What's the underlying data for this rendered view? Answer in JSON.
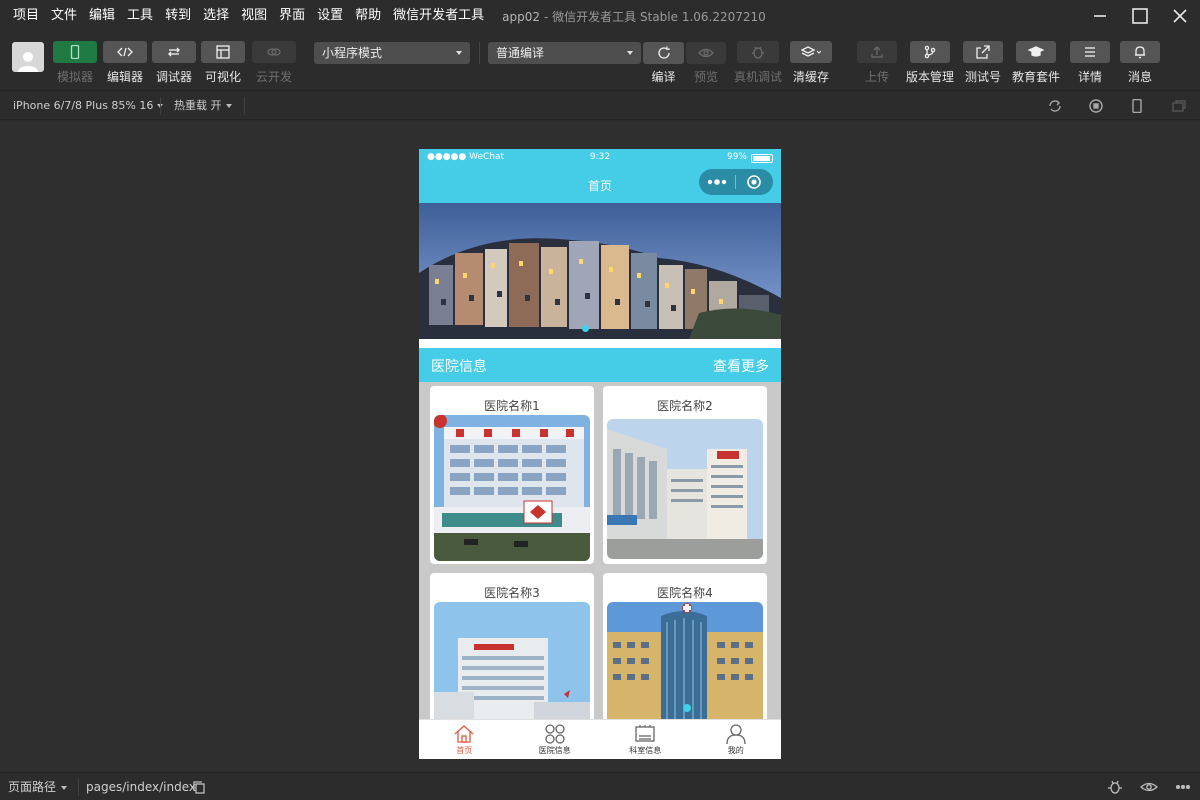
{
  "menu": [
    "项目",
    "文件",
    "编辑",
    "工具",
    "转到",
    "选择",
    "视图",
    "界面",
    "设置",
    "帮助",
    "微信开发者工具"
  ],
  "app": {
    "name": "app02",
    "subtitle": "- 微信开发者工具 Stable 1.06.2207210"
  },
  "toolbar": {
    "simulator": "模拟器",
    "editor": "编辑器",
    "debugger": "调试器",
    "visualize": "可视化",
    "cloud": "云开发",
    "mode_select": "小程序模式",
    "compile_select": "普通编译",
    "compile": "编译",
    "preview": "预览",
    "real_debug": "真机调试",
    "clear_cache": "清缓存",
    "upload": "上传",
    "version_mgmt": "版本管理",
    "test_account": "测试号",
    "edu_kit": "教育套件",
    "details": "详情",
    "messages": "消息"
  },
  "subbar": {
    "device": "iPhone 6/7/8 Plus 85% 16",
    "hot_reload": "热重载 开"
  },
  "phone": {
    "carrier": "●●●●● WeChat",
    "time": "9:32",
    "battery": "99%",
    "nav_title": "首页",
    "section_title": "医院信息",
    "section_more": "查看更多",
    "cards": [
      {
        "title": "医院名称1"
      },
      {
        "title": "医院名称2"
      },
      {
        "title": "医院名称3"
      },
      {
        "title": "医院名称4"
      }
    ],
    "tabs": [
      {
        "label": "首页",
        "icon": "home-icon",
        "active": true
      },
      {
        "label": "医院信息",
        "icon": "grid-icon",
        "active": false
      },
      {
        "label": "科室信息",
        "icon": "board-icon",
        "active": false
      },
      {
        "label": "我的",
        "icon": "user-icon",
        "active": false
      }
    ]
  },
  "bottombar": {
    "page_path_label": "页面路径",
    "page_path": "pages/index/index"
  },
  "colors": {
    "brand": "#45cde8",
    "active_tab": "#e0593f",
    "simulator_active": "#1f7a44"
  }
}
